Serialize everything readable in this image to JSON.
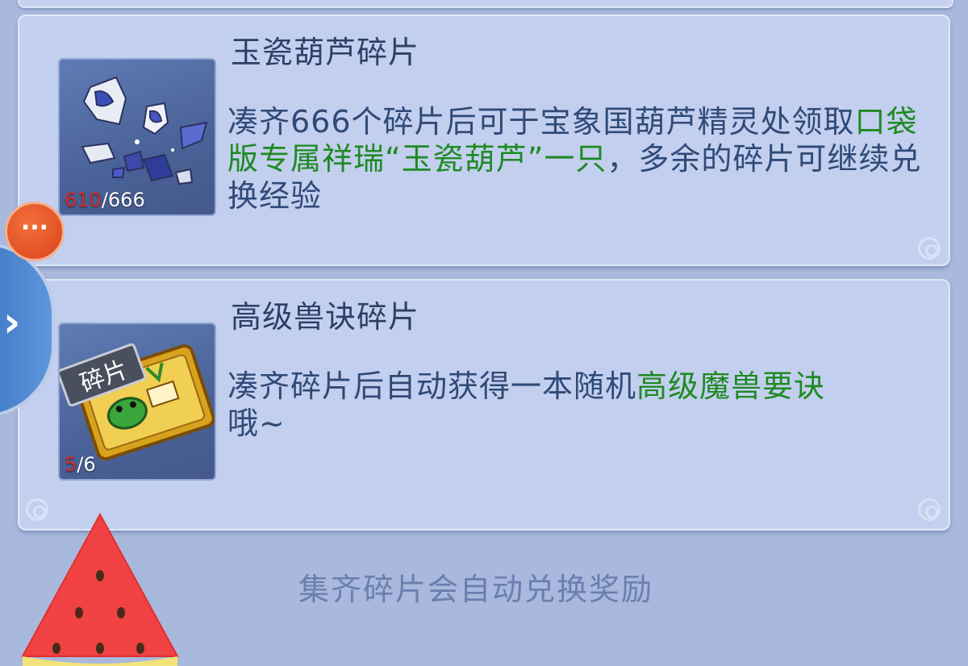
{
  "items": [
    {
      "name": "玉瓷葫芦碎片",
      "count_current": "610",
      "count_total": "/666",
      "desc_part1": "凑齐666个碎片后可于宝象国葫芦精灵处领取",
      "desc_highlight": "口袋版专属祥瑞“玉瓷葫芦”一只",
      "desc_part2": "，多余的碎片可继续兑换经验",
      "icon": "porcelain-gourd-shards-icon"
    },
    {
      "name": "高级兽诀碎片",
      "count_current": "5",
      "count_total": "/6",
      "desc_part1": "凑齐碎片后自动获得一本随机",
      "desc_highlight": "高级魔兽要诀",
      "desc_part2": "哦~",
      "badge": "碎片",
      "icon": "beast-skill-scroll-icon"
    }
  ],
  "footer": {
    "note": "集齐碎片会自动兑换奖励"
  },
  "more_button": {
    "label": "···"
  },
  "colors": {
    "highlight": "#1e8a23",
    "count_current": "#d62a2a",
    "panel_bg": "#c3cfee",
    "page_bg": "#a9b8dd"
  }
}
